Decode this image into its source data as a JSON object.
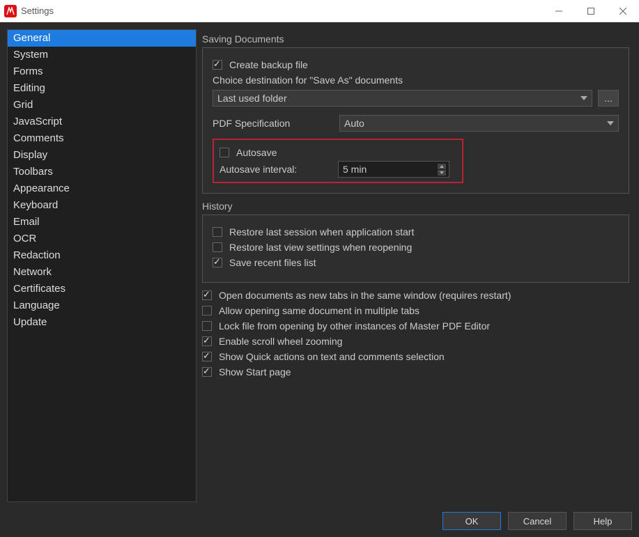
{
  "window": {
    "title": "Settings"
  },
  "sidebar": {
    "items": [
      {
        "label": "General",
        "selected": true
      },
      {
        "label": "System"
      },
      {
        "label": "Forms"
      },
      {
        "label": "Editing"
      },
      {
        "label": "Grid"
      },
      {
        "label": "JavaScript"
      },
      {
        "label": "Comments"
      },
      {
        "label": "Display"
      },
      {
        "label": "Toolbars"
      },
      {
        "label": "Appearance"
      },
      {
        "label": "Keyboard"
      },
      {
        "label": "Email"
      },
      {
        "label": "OCR"
      },
      {
        "label": "Redaction"
      },
      {
        "label": "Network"
      },
      {
        "label": "Certificates"
      },
      {
        "label": "Language"
      },
      {
        "label": "Update"
      }
    ]
  },
  "saving": {
    "title": "Saving Documents",
    "create_backup": "Create backup file",
    "choice_dest_label": "Choice destination for \"Save As\" documents",
    "folder_value": "Last used folder",
    "browse_label": "...",
    "pdf_spec_label": "PDF Specification",
    "pdf_spec_value": "Auto",
    "autosave_label": "Autosave",
    "autosave_interval_label": "Autosave interval:",
    "autosave_interval_value": "5 min"
  },
  "history": {
    "title": "History",
    "restore_session": "Restore last session when application start",
    "restore_view": "Restore last view settings when reopening",
    "save_recent": "Save recent files list"
  },
  "options": {
    "new_tabs": "Open documents as new tabs in the same window (requires restart)",
    "allow_multi": "Allow opening same document in multiple tabs",
    "lock_file": "Lock file from opening by other instances of Master PDF Editor",
    "scroll_zoom": "Enable scroll wheel zooming",
    "quick_actions": "Show Quick actions on text and comments selection",
    "start_page": "Show Start page"
  },
  "buttons": {
    "ok": "OK",
    "cancel": "Cancel",
    "help": "Help"
  }
}
